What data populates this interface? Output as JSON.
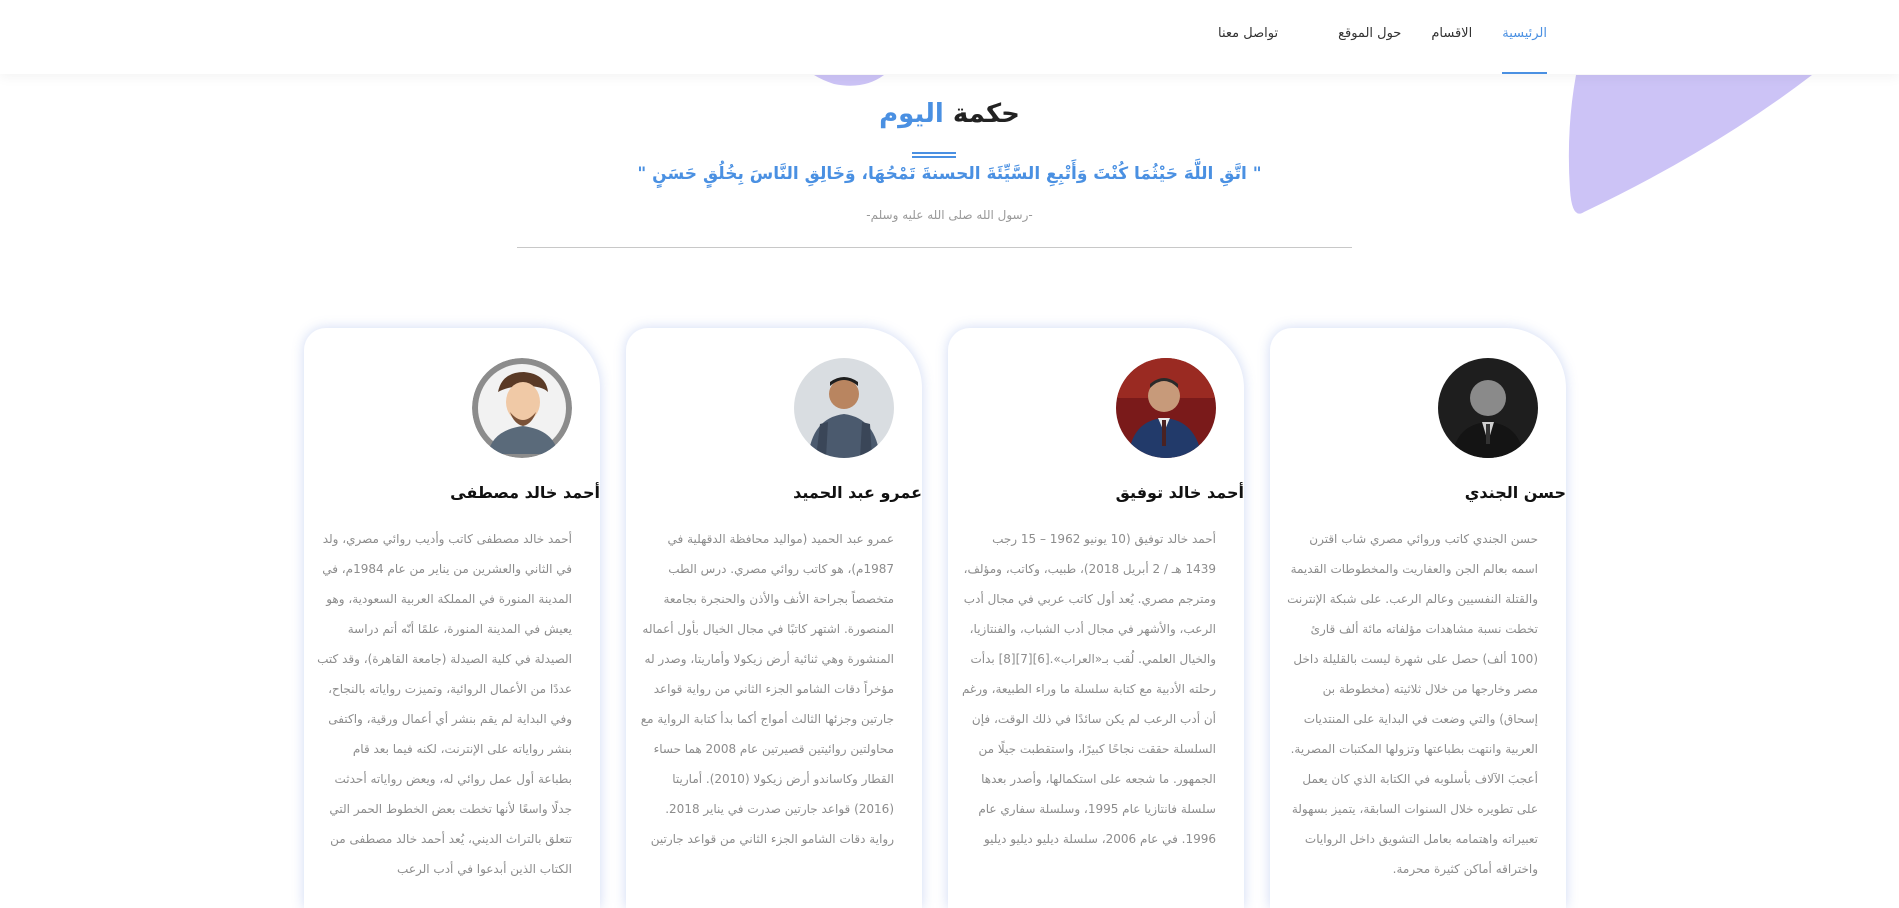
{
  "nav": {
    "items": [
      {
        "label": "الرئيسية",
        "active": true
      },
      {
        "label": "الاقسام",
        "active": false
      },
      {
        "label": "حول الموقع",
        "active": false
      },
      {
        "label": "تواصل معنا",
        "active": false
      }
    ]
  },
  "wisdom": {
    "title_main": "حكمة",
    "title_accent": "اليوم",
    "quote": "\" اتَّقِ اللَّهَ حَيْثُمَا كُنْتَ وَأَتْبِعِ السَّيِّئَةَ الحسنةَ تَمْحُهَا، وَخَالِقِ النَّاسَ بِخُلُقٍ حَسَنٍ \"",
    "source": "-رسول الله صلى الله عليه وسلم-"
  },
  "authors": [
    {
      "name": "حسن الجندي",
      "bio": "حسن الجندي كاتب وروائي مصري شاب اقترن اسمه بعالم الجن والعفاريت والمخطوطات القديمة والقتلة النفسيين وعالم الرعب. على شبكة الإنترنت تخطت نسبة مشاهدات مؤلفاته مائة ألف قارئ (100 ألف) حصل على شهرة ليست بالقليلة داخل مصر وخارجها من خلال ثلاثيته (مخطوطة بن إسحاق) والتي وضعت في البداية على المنتديات العربية وانتهت بطباعتها وتزولها المكتبات المصرية. أعجبَ الآلاف بأسلوبه في الكتابة الذي كان يعمل على تطويره خلال السنوات السابقة، يتميز بسهولة تعبيراته واهتمامه بعامل التشويق داخل الروايات واختراقه أماكن كثيرة محرمة."
    },
    {
      "name": "أحمد خالد توفيق",
      "bio": "أحمد خالد توفيق (10 يونيو 1962 – 15 رجب 1439 هـ / 2 أبريل 2018)، طبيب، وكاتب، ومؤلف، ومترجم مصري. يُعد أول كاتب عربي في مجال أدب الرعب، والأشهر في مجال أدب الشباب، والفنتازيا، والخيال العلمي. لُقب بـ«العراب».[6][7][8] بدأت رحلته الأدبية مع كتابة سلسلة ما وراء الطبيعة، ورغم أن أدب الرعب لم يكن سائدًا في ذلك الوقت، فإن السلسلة حققت نجاحًا كبيرًا، واستقطبت جيلًا من الجمهور. ما شجعه على استكمالها، وأصدر بعدها سلسلة فانتازيا عام 1995، وسلسلة سفاري عام 1996. في عام 2006، سلسلة ديليو ديليو ديليو"
    },
    {
      "name": "عمرو عبد الحميد",
      "bio": "عمرو عبد الحميد (مواليد محافظة الدقهلية في 1987م)، هو كاتب روائي مصري. درس الطب متخصصاً بجراحة الأنف والأذن والحنجرة بجامعة المنصورة. اشتهر كاتبًا في مجال الخيال بأول أعماله المنشورة وهي ثنائية أرض زيكولا وأماريتا، وصدر له مؤخراً دقات الشامو الجزء الثاني من رواية قواعد جارتين وجزئها الثالث أمواج أكما بدأ كتابة الرواية مع محاولتين روائيتين قصيرتين عام 2008 هما حساء القطار وكاساندو أرض زيكولا (2010). أماريتا (2016) قواعد جارتين صدرت في يناير 2018. رواية دقات الشامو الجزء الثاني من قواعد جارتين"
    },
    {
      "name": "أحمد خالد مصطفى",
      "bio": "أحمد خالد مصطفى كاتب وأديب روائي مصري، ولد في الثاني والعشرين من يناير من عام 1984م، في المدينة المنورة في المملكة العربية السعودية، وهو يعيش في المدينة المنورة، علمًا أنّه أتم دراسة الصيدلة في كلية الصيدلة (جامعة القاهرة)، وقد كتب عددًا من الأعمال الروائية، وتميزت رواياته بالنجاح، وفي البداية لم يقم بنشر أي أعمال ورقية، واكتفى بنشر رواياته على الإنترنت، لكنه فيما بعد قام بطباعة أول عمل روائي له، ويعض رواياته أحدثت جدلًا واسعًا لأنها تخطت بعض الخطوط الحمر التي تتعلق بالتراث الديني، يُعد أحمد خالد مصطفى من الكتاب الذين أبدعوا في أدب الرعب"
    }
  ]
}
